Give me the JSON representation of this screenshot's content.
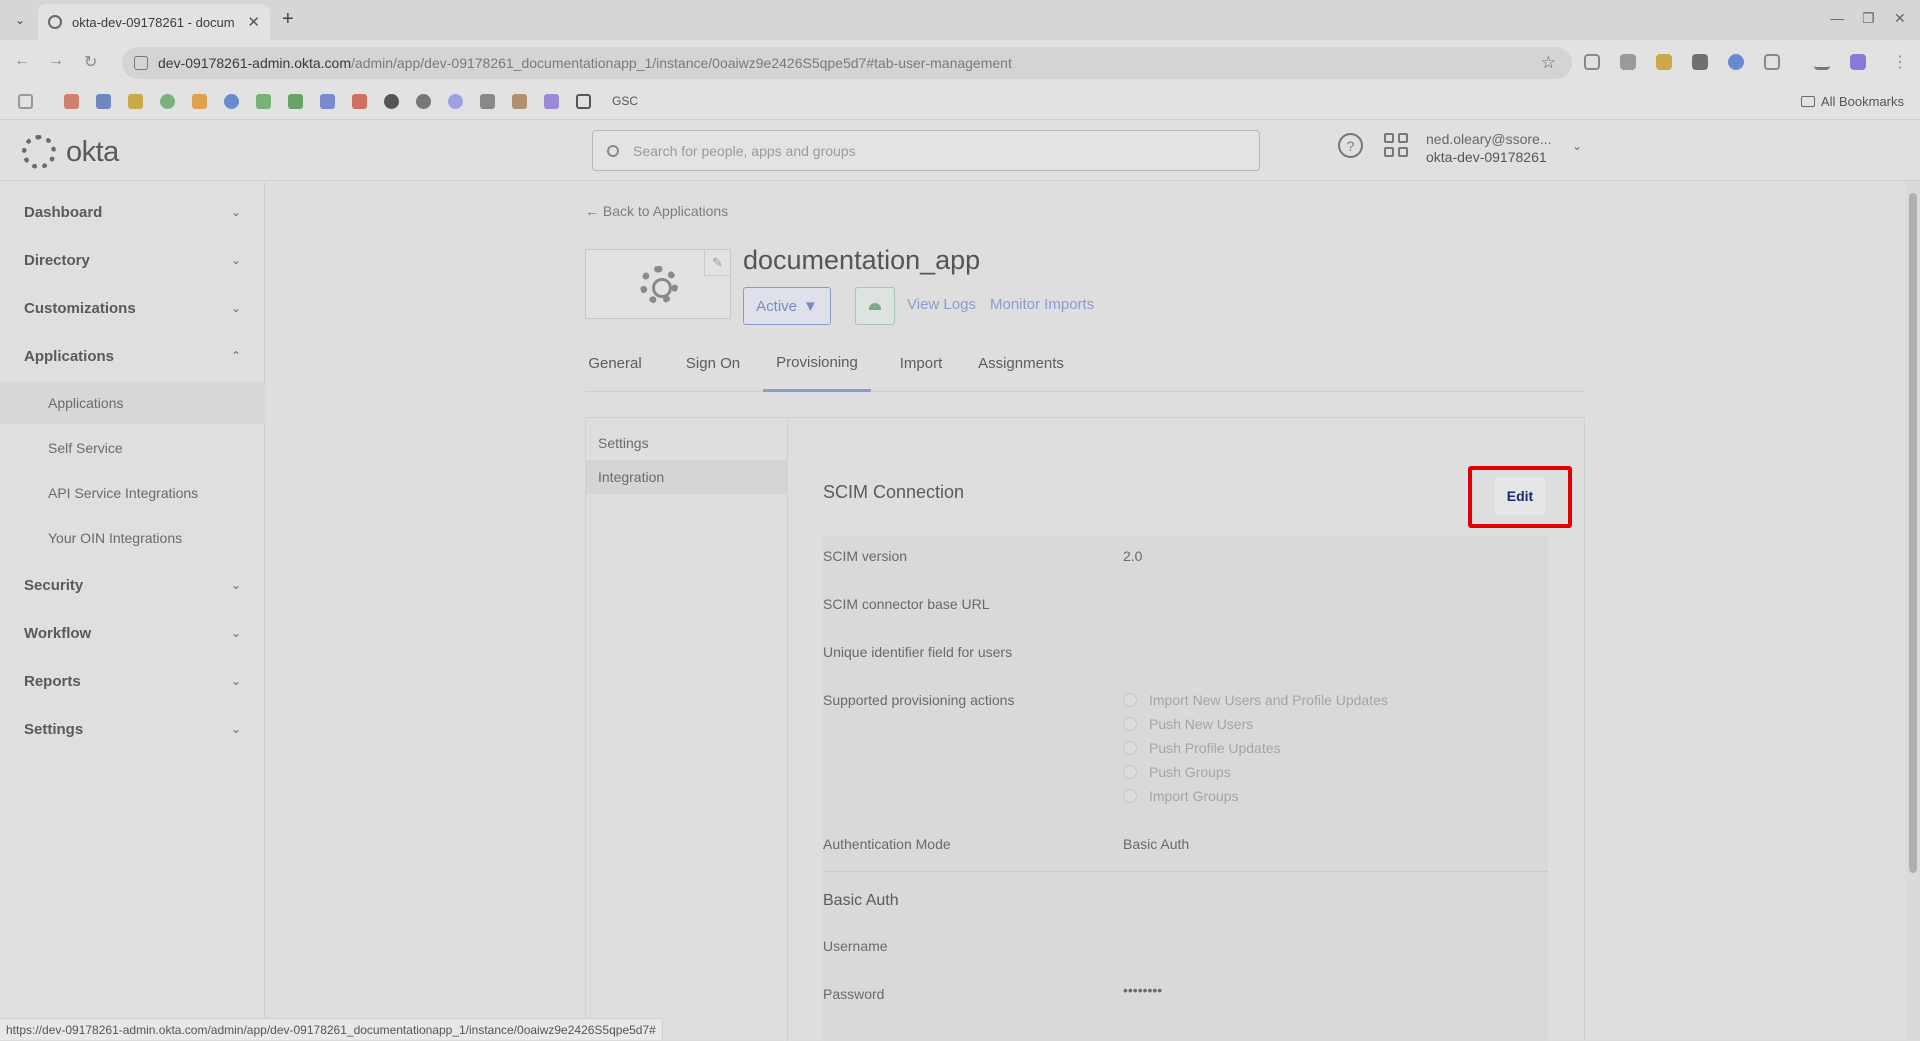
{
  "browser": {
    "tab_title": "okta-dev-09178261 - docum",
    "url_host": "dev-09178261-admin.okta.com",
    "url_path": "/admin/app/dev-09178261_documentationapp_1/instance/0oaiwz9e2426S5qpe5d7#tab-user-management",
    "bookmark_gsc": "GSC",
    "all_bookmarks": "All Bookmarks",
    "status_url": "https://dev-09178261-admin.okta.com/admin/app/dev-09178261_documentationapp_1/instance/0oaiwz9e2426S5qpe5d7#"
  },
  "header": {
    "logo": "okta",
    "search_placeholder": "Search for people, apps and groups",
    "user_email": "ned.oleary@ssore...",
    "user_org": "okta-dev-09178261"
  },
  "sidebar": {
    "sections": [
      {
        "label": "Dashboard"
      },
      {
        "label": "Directory"
      },
      {
        "label": "Customizations"
      },
      {
        "label": "Applications"
      },
      {
        "label": "Security"
      },
      {
        "label": "Workflow"
      },
      {
        "label": "Reports"
      },
      {
        "label": "Settings"
      }
    ],
    "app_sub": [
      "Applications",
      "Self Service",
      "API Service Integrations",
      "Your OIN Integrations"
    ]
  },
  "content": {
    "back_link": "← Back to Applications",
    "app_title": "documentation_app",
    "status": "Active",
    "view_logs": "View Logs",
    "monitor_imports": "Monitor Imports",
    "tabs": [
      "General",
      "Sign On",
      "Provisioning",
      "Import",
      "Assignments"
    ],
    "settings_nav": [
      "Settings",
      "Integration"
    ],
    "scim_title": "SCIM Connection",
    "edit": "Edit",
    "fields": {
      "scim_version_label": "SCIM version",
      "scim_version_value": "2.0",
      "base_url_label": "SCIM connector base URL",
      "unique_id_label": "Unique identifier field for users",
      "actions_label": "Supported provisioning actions",
      "actions": [
        "Import New Users and Profile Updates",
        "Push New Users",
        "Push Profile Updates",
        "Push Groups",
        "Import Groups"
      ],
      "auth_mode_label": "Authentication Mode",
      "auth_mode_value": "Basic Auth",
      "basic_auth_title": "Basic Auth",
      "username_label": "Username",
      "password_label": "Password",
      "password_value": "••••••••"
    }
  }
}
